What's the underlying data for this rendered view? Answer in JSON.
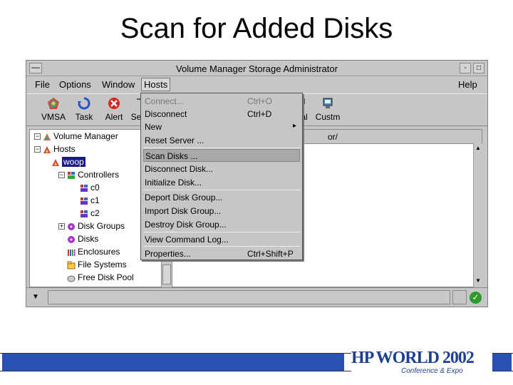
{
  "slide": {
    "title": "Scan for Added Disks"
  },
  "window": {
    "title": "Volume Manager Storage Administrator",
    "sysmenu_glyph": "—",
    "minimize_glyph": "-",
    "maximize_glyph": "□"
  },
  "menubar": {
    "items": [
      "File",
      "Options",
      "Window",
      "Hosts"
    ],
    "help": "Help"
  },
  "toolbar": {
    "buttons": [
      "VMSA",
      "Task",
      "Alert",
      "Se",
      "al",
      "Custm"
    ]
  },
  "tree": {
    "nodes": [
      "Volume Manager",
      "Hosts",
      "woop",
      "Controllers",
      "c0",
      "c1",
      "c2",
      "Disk Groups",
      "Disks",
      "Enclosures",
      "File Systems",
      "Free Disk Pool"
    ]
  },
  "right_pane": {
    "column_header": "or/"
  },
  "hosts_menu": {
    "items": [
      {
        "label": "Connect...",
        "shortcut": "Ctrl+O"
      },
      {
        "label": "Disconnect",
        "shortcut": "Ctrl+D"
      },
      {
        "label": "New",
        "shortcut": ""
      },
      {
        "label": "Reset Server ...",
        "shortcut": ""
      },
      {
        "label": "Scan Disks ...",
        "shortcut": ""
      },
      {
        "label": "Disconnect Disk...",
        "shortcut": ""
      },
      {
        "label": "Initialize Disk...",
        "shortcut": ""
      },
      {
        "label": "Deport Disk Group...",
        "shortcut": ""
      },
      {
        "label": "Import Disk Group...",
        "shortcut": ""
      },
      {
        "label": "Destroy Disk Group...",
        "shortcut": ""
      },
      {
        "label": "View Command Log...",
        "shortcut": ""
      },
      {
        "label": "Properties...",
        "shortcut": "Ctrl+Shift+P"
      }
    ],
    "submenu_glyph": "▸"
  },
  "status": {
    "ok_glyph": "✓"
  },
  "footer": {
    "logo_text": "HP WORLD 2002",
    "logo_subtext": "Conference & Expo"
  },
  "colors": {
    "footer_blue": "#2a52b3",
    "tree_selection": "#1a1a8c",
    "window_gray": "#c6c6c6"
  }
}
